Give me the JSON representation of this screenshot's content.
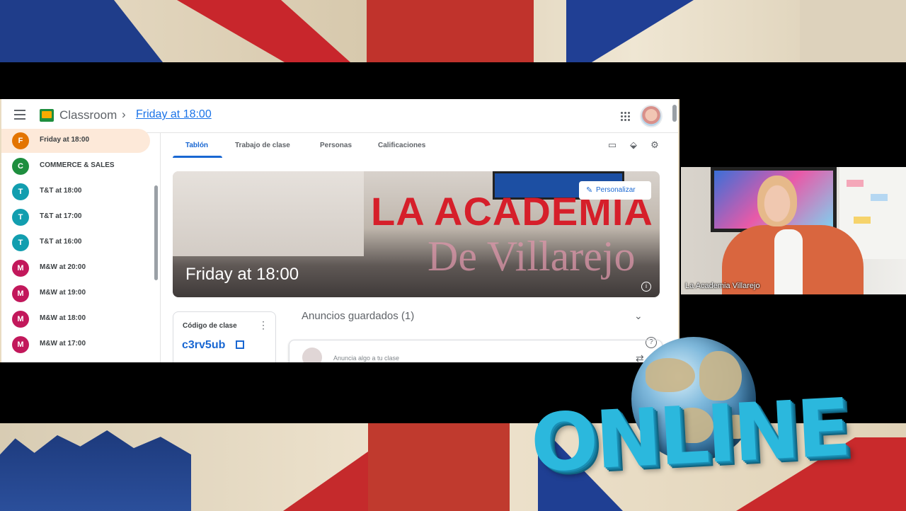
{
  "classroom": {
    "app_name": "Classroom",
    "breadcrumb_separator": "›",
    "current_class": "Friday at 18:00",
    "sidebar": {
      "items": [
        {
          "initial": "F",
          "label": "Friday at 18:00",
          "color": "#e37400",
          "active": true
        },
        {
          "initial": "C",
          "label": "COMMERCE & SALES",
          "color": "#1e8e3e",
          "active": false
        },
        {
          "initial": "T",
          "label": "T&T at 18:00",
          "color": "#129eaf",
          "active": false
        },
        {
          "initial": "T",
          "label": "T&T at 17:00",
          "color": "#129eaf",
          "active": false
        },
        {
          "initial": "T",
          "label": "T&T at 16:00",
          "color": "#129eaf",
          "active": false
        },
        {
          "initial": "M",
          "label": "M&W at 20:00",
          "color": "#c2185b",
          "active": false
        },
        {
          "initial": "M",
          "label": "M&W at 19:00",
          "color": "#c2185b",
          "active": false
        },
        {
          "initial": "M",
          "label": "M&W at 18:00",
          "color": "#c2185b",
          "active": false
        },
        {
          "initial": "M",
          "label": "M&W at 17:00",
          "color": "#c2185b",
          "active": false
        }
      ]
    },
    "tabs": [
      {
        "label": "Tablón",
        "active": true
      },
      {
        "label": "Trabajo de clase",
        "active": false
      },
      {
        "label": "Personas",
        "active": false
      },
      {
        "label": "Calificaciones",
        "active": false
      }
    ],
    "banner": {
      "title": "LA ACADEMIA",
      "subtitle": "De Villarejo",
      "class_name": "Friday at 18:00",
      "customize_label": "Personalizar",
      "info_glyph": "i"
    },
    "class_code": {
      "label": "Código de clase",
      "more_glyph": "⋮",
      "value": "c3rv5ub"
    },
    "saved_announcements": "Anuncios guardados (1)",
    "announce_placeholder": "Anuncia algo a tu clase",
    "icons": {
      "calendar": "▭",
      "drive": "⬙",
      "settings": "⚙",
      "help": "?",
      "repost": "⇄",
      "chevron": "⌄"
    }
  },
  "webcam": {
    "label": "La Academia Villarejo"
  },
  "overlay": {
    "online_text": "ONLINE"
  },
  "colors": {
    "accent": "#1967d2",
    "banner_red": "#d61f2a",
    "online_blue": "#2bb8dd"
  }
}
